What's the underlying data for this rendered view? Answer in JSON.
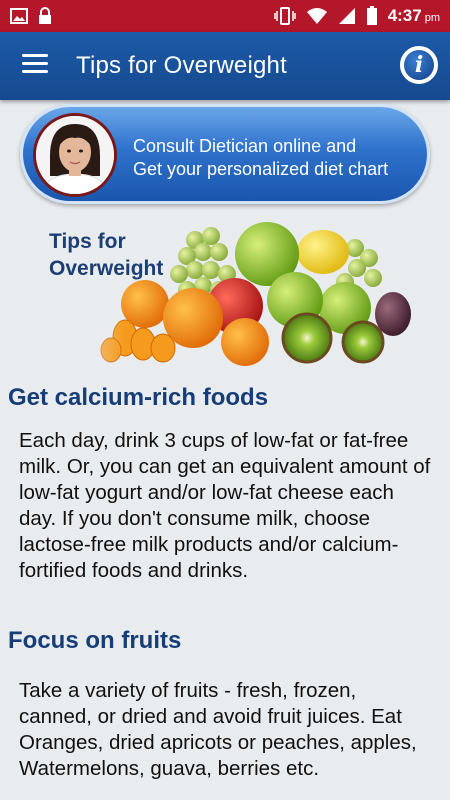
{
  "status_bar": {
    "time": "4:37",
    "ampm": "pm",
    "left_icons": [
      "image-icon",
      "lock-icon"
    ],
    "right_icons": [
      "vibrate-icon",
      "wifi-icon",
      "signal-icon",
      "battery-icon"
    ]
  },
  "appbar": {
    "title": "Tips for Overweight",
    "menu_icon": "hamburger-icon",
    "info_icon": "info-icon"
  },
  "consult_banner": {
    "line1": "Consult Dietician online and",
    "line2": "Get your personalized diet chart"
  },
  "hero": {
    "title_line1": "Tips for",
    "title_line2": "Overweight"
  },
  "sections": [
    {
      "heading": "Get calcium-rich foods",
      "body": "Each day, drink 3 cups of low-fat or fat-free milk. Or, you can get an equivalent amount of low-fat yogurt and/or low-fat cheese each day. If you don't consume milk, choose lactose-free milk products and/or calcium-fortified foods and drinks."
    },
    {
      "heading": "Focus on fruits",
      "body": "Take a variety of fruits - fresh, frozen, canned, or dried and avoid fruit juices. Eat Oranges, dried apricots or peaches, apples, Watermelons, guava, berries etc."
    }
  ],
  "colors": {
    "status_bar": "#b5172a",
    "app_bar": "#1d5aa8",
    "heading": "#173d78",
    "background": "#e9ecef"
  }
}
